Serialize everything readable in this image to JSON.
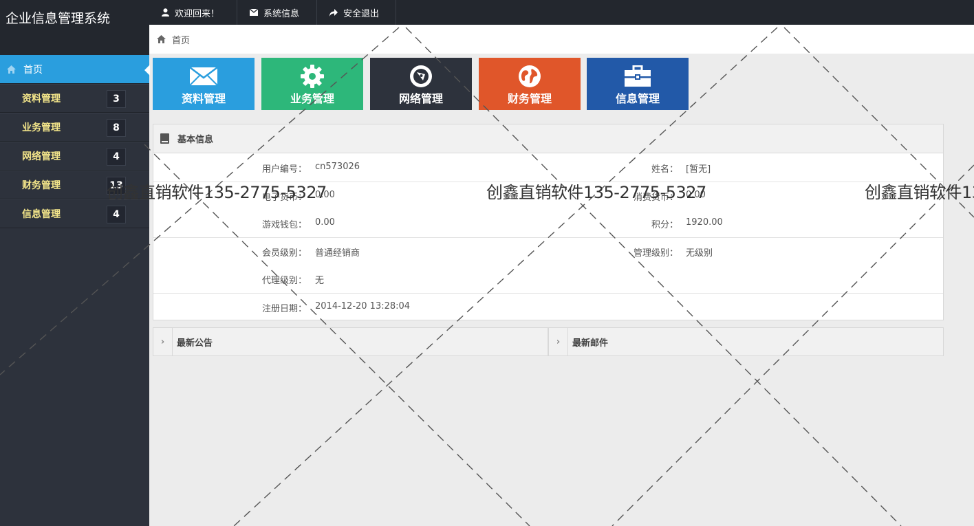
{
  "app": {
    "title": "企业信息管理系统"
  },
  "sidebar": {
    "items": [
      {
        "label": "首页",
        "badge": "",
        "active": true
      },
      {
        "label": "资料管理",
        "badge": "3"
      },
      {
        "label": "业务管理",
        "badge": "8"
      },
      {
        "label": "网络管理",
        "badge": "4"
      },
      {
        "label": "财务管理",
        "badge": "13"
      },
      {
        "label": "信息管理",
        "badge": "4"
      }
    ]
  },
  "topbar": {
    "welcome": "欢迎回来！",
    "sysinfo": "系统信息",
    "logout": "安全退出"
  },
  "breadcrumb": {
    "home": "首页"
  },
  "tiles": [
    {
      "label": "资料管理",
      "icon": "envelope-icon",
      "color": "#2a9ede"
    },
    {
      "label": "业务管理",
      "icon": "gear-icon",
      "color": "#2db77a"
    },
    {
      "label": "网络管理",
      "icon": "compass-icon",
      "color": "#2d323c"
    },
    {
      "label": "财务管理",
      "icon": "globe-icon",
      "color": "#e0562a"
    },
    {
      "label": "信息管理",
      "icon": "briefcase-icon",
      "color": "#2259a8"
    }
  ],
  "basic_info": {
    "title": "基本信息",
    "user_id_label": "用户编号：",
    "user_id": "cn573026",
    "name_label": "姓名：",
    "name": "[暂无]",
    "e_currency_label": "电子货币：",
    "e_currency": "0.00",
    "consume_currency_label": "消费货币：",
    "consume_currency": "0.00",
    "game_wallet_label": "游戏钱包：",
    "game_wallet": "0.00",
    "points_label": "积分：",
    "points": "1920.00",
    "member_level_label": "会员级别：",
    "member_level": "普通经销商",
    "admin_level_label": "管理级别：",
    "admin_level": "无级别",
    "agent_level_label": "代理级别：",
    "agent_level": "无",
    "register_date_label": "注册日期：",
    "register_date": "2014-12-20 13:28:04"
  },
  "announcements": {
    "title": "最新公告"
  },
  "mail": {
    "title": "最新邮件"
  },
  "watermark": {
    "text": "创鑫直销软件135-2775-5327"
  }
}
